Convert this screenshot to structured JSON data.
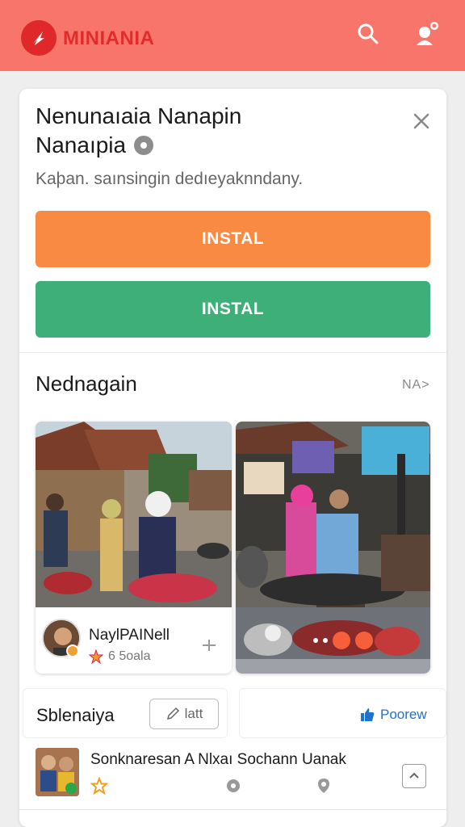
{
  "header": {
    "brand": "MINIANIA",
    "colors": {
      "bar": "#f7756a",
      "logo": "#e0282a",
      "brand_text": "#e12c2c"
    },
    "icons": [
      "search-icon",
      "user-icon"
    ]
  },
  "card": {
    "title_line1": "Nenunaıaia Nanapin",
    "title_line2": "Nanaıpia",
    "subtitle": "Kaþan. saınsingin dedıeyaknndany.",
    "install_orange": "INSTAL",
    "install_green": "INSTAL",
    "colors": {
      "orange": "#f88a43",
      "green": "#3faf79"
    }
  },
  "section": {
    "title": "Nednagain",
    "more": "NA>",
    "card1": {
      "name": "NaylPAINell",
      "meta": "6 5oala"
    }
  },
  "subcards": {
    "left_title": "Sblenaiya",
    "edit_label": "latt",
    "preview_label": "Poorew"
  },
  "list": {
    "item1_title": "Sonknaresan A Nlxaı Sochann Uanak"
  }
}
